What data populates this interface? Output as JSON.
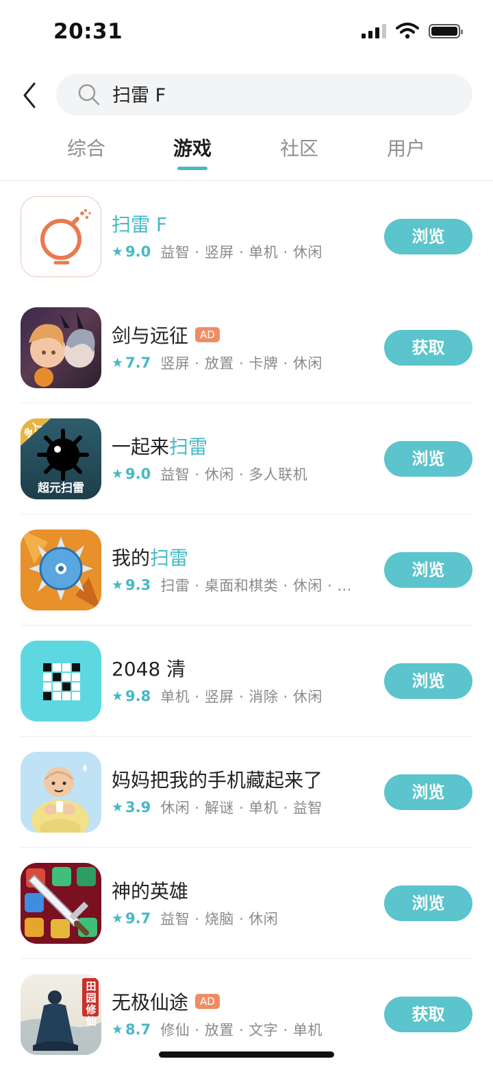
{
  "status_bar": {
    "time": "20:31"
  },
  "search": {
    "query": "扫雷 F"
  },
  "tabs": [
    {
      "label": "综合",
      "active": false
    },
    {
      "label": "游戏",
      "active": true
    },
    {
      "label": "社区",
      "active": false
    },
    {
      "label": "用户",
      "active": false
    }
  ],
  "accent_color": "#46b9c4",
  "button_color": "#5bc4cc",
  "ad_badge_color": "#f08c64",
  "apps": [
    {
      "name_plain": "",
      "name_highlight": "扫雷 F",
      "ad": "",
      "score": "9.0",
      "tags": "益智 · 竖屏 · 单机 · 休闲",
      "action": "浏览",
      "icon": "bomb-icon"
    },
    {
      "name_plain": "剑与远征",
      "name_highlight": "",
      "ad": "AD",
      "score": "7.7",
      "tags": "竖屏 · 放置 · 卡牌 · 休闲",
      "action": "获取",
      "icon": "anime-characters-icon"
    },
    {
      "name_plain": "一起来",
      "name_highlight": "扫雷",
      "ad": "",
      "score": "9.0",
      "tags": "益智 · 休闲 · 多人联机",
      "action": "浏览",
      "icon": "mine-icon",
      "icon_text_top": "多人",
      "icon_text_bottom": "超元扫雷"
    },
    {
      "name_plain": "我的",
      "name_highlight": "扫雷",
      "ad": "",
      "score": "9.3",
      "tags": "扫雷 · 桌面和棋类 · 休闲 · …",
      "action": "浏览",
      "icon": "spiked-mine-icon"
    },
    {
      "name_plain": "2048 清",
      "name_highlight": "",
      "ad": "",
      "score": "9.8",
      "tags": "单机 · 竖屏 · 消除 · 休闲",
      "action": "浏览",
      "icon": "grid-puzzle-icon"
    },
    {
      "name_plain": "妈妈把我的手机藏起来了",
      "name_highlight": "",
      "ad": "",
      "score": "3.9",
      "tags": "休闲 · 解谜 · 单机 · 益智",
      "action": "浏览",
      "icon": "old-man-icon"
    },
    {
      "name_plain": "神的英雄",
      "name_highlight": "",
      "ad": "",
      "score": "9.7",
      "tags": "益智 · 烧脑 · 休闲",
      "action": "浏览",
      "icon": "sword-gems-icon"
    },
    {
      "name_plain": "无极仙途",
      "name_highlight": "",
      "ad": "AD",
      "score": "8.7",
      "tags": "修仙 · 放置 · 文字 · 单机",
      "action": "获取",
      "icon": "cultivator-icon",
      "icon_text_side": "田园修仙"
    }
  ]
}
